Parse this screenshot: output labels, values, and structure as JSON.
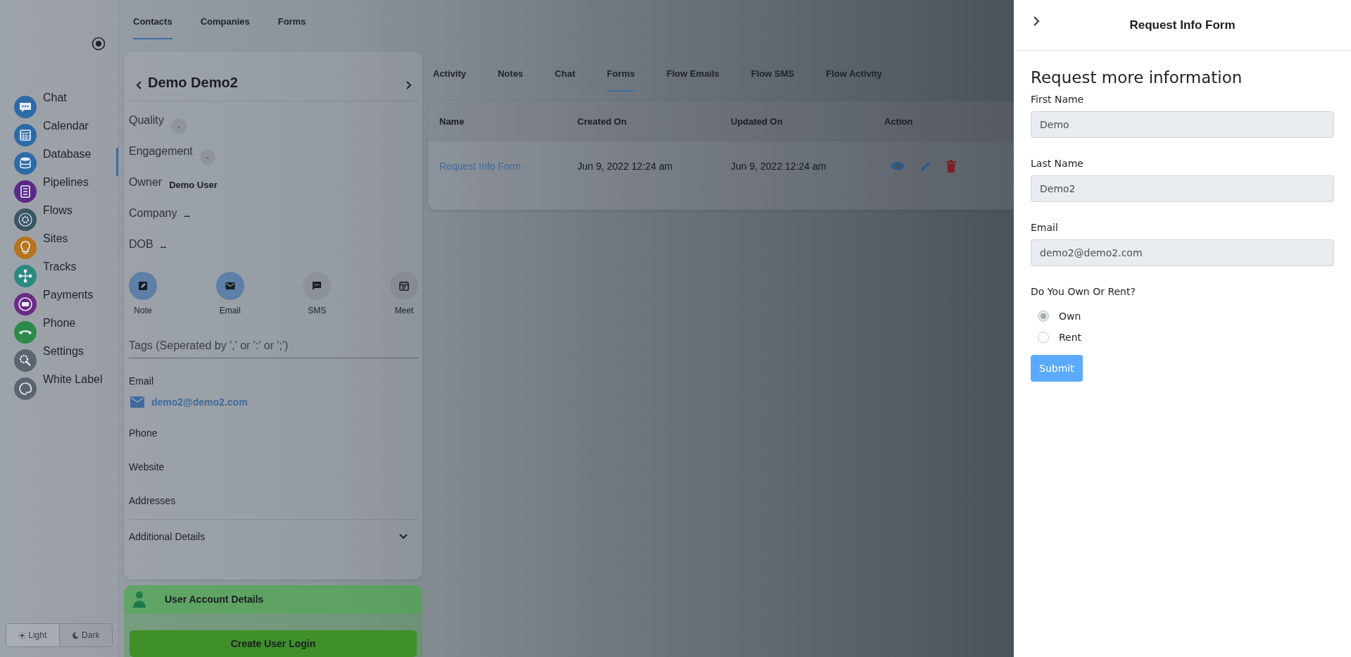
{
  "sidebar": {
    "items": [
      {
        "label": "Chat",
        "color": "#2e6aa6",
        "selected": false
      },
      {
        "label": "Calendar",
        "color": "#2e6aa6",
        "selected": false
      },
      {
        "label": "Database",
        "color": "#2e6aa6",
        "selected": true
      },
      {
        "label": "Pipelines",
        "color": "#5b2a86",
        "selected": false
      },
      {
        "label": "Flows",
        "color": "#3a5566",
        "selected": false
      },
      {
        "label": "Sites",
        "color": "#b8731e",
        "selected": false
      },
      {
        "label": "Tracks",
        "color": "#2a8a80",
        "selected": false
      },
      {
        "label": "Payments",
        "color": "#6a2a86",
        "selected": false
      },
      {
        "label": "Phone",
        "color": "#2e8a4a",
        "selected": false
      },
      {
        "label": "Settings",
        "color": "#5c6470",
        "selected": false
      },
      {
        "label": "White Label",
        "color": "#5c6470",
        "selected": false
      }
    ]
  },
  "theme_toggle": [
    {
      "label": "Light",
      "selected": true
    },
    {
      "label": "Dark",
      "selected": false
    }
  ],
  "top_tabs": [
    {
      "label": "Contacts",
      "selected": true
    },
    {
      "label": "Companies",
      "selected": false
    },
    {
      "label": "Forms",
      "selected": false
    }
  ],
  "contact": {
    "name": "Demo Demo2",
    "fields": [
      {
        "label": "Quality",
        "value": "-",
        "kind": "chip"
      },
      {
        "label": "Engagement",
        "value": "-",
        "kind": "chip"
      },
      {
        "label": "Owner",
        "value": "Demo User",
        "kind": "text"
      },
      {
        "label": "Company",
        "value": "--",
        "kind": "text"
      },
      {
        "label": "DOB",
        "value": "--",
        "kind": "text"
      }
    ],
    "actions": [
      {
        "label": "Note",
        "active": true
      },
      {
        "label": "Email",
        "active": true
      },
      {
        "label": "SMS",
        "active": false
      },
      {
        "label": "Meet",
        "active": false
      }
    ],
    "tags": {
      "placeholder": "Tags (Seperated by ',' or ':' or ';')"
    },
    "email_label": "Email",
    "email": "demo2@demo2.com",
    "sections": [
      "Phone",
      "Website",
      "Addresses"
    ],
    "additional": {
      "label": "Additional Details",
      "expanded": false
    }
  },
  "user_account": {
    "title": "User Account Details",
    "button": "Create User Login"
  },
  "detail_tabs": [
    {
      "label": "Activity",
      "selected": false
    },
    {
      "label": "Notes",
      "selected": false
    },
    {
      "label": "Chat",
      "selected": false
    },
    {
      "label": "Forms",
      "selected": true
    },
    {
      "label": "Flow Emails",
      "selected": false
    },
    {
      "label": "Flow SMS",
      "selected": false
    },
    {
      "label": "Flow Activity",
      "selected": false
    }
  ],
  "forms_table": {
    "columns": [
      "Name",
      "Created On",
      "Updated On",
      "Action"
    ],
    "rows": [
      {
        "name": "Request Info Form",
        "created_on": "Jun 9, 2022 12:24 am",
        "updated_on": "Jun 9, 2022 12:24 am"
      }
    ]
  },
  "drawer": {
    "title": "Request Info Form",
    "heading": "Request more information",
    "fields": [
      {
        "label": "First Name",
        "value": "Demo",
        "disabled": true
      },
      {
        "label": "Last Name",
        "value": "Demo2",
        "disabled": true
      },
      {
        "label": "Email",
        "value": "demo2@demo2.com",
        "disabled": true
      }
    ],
    "question": {
      "label": "Do You Own Or Rent?",
      "options": [
        {
          "label": "Own",
          "selected": true
        },
        {
          "label": "Rent",
          "selected": false
        }
      ]
    },
    "submit": "Submit"
  }
}
